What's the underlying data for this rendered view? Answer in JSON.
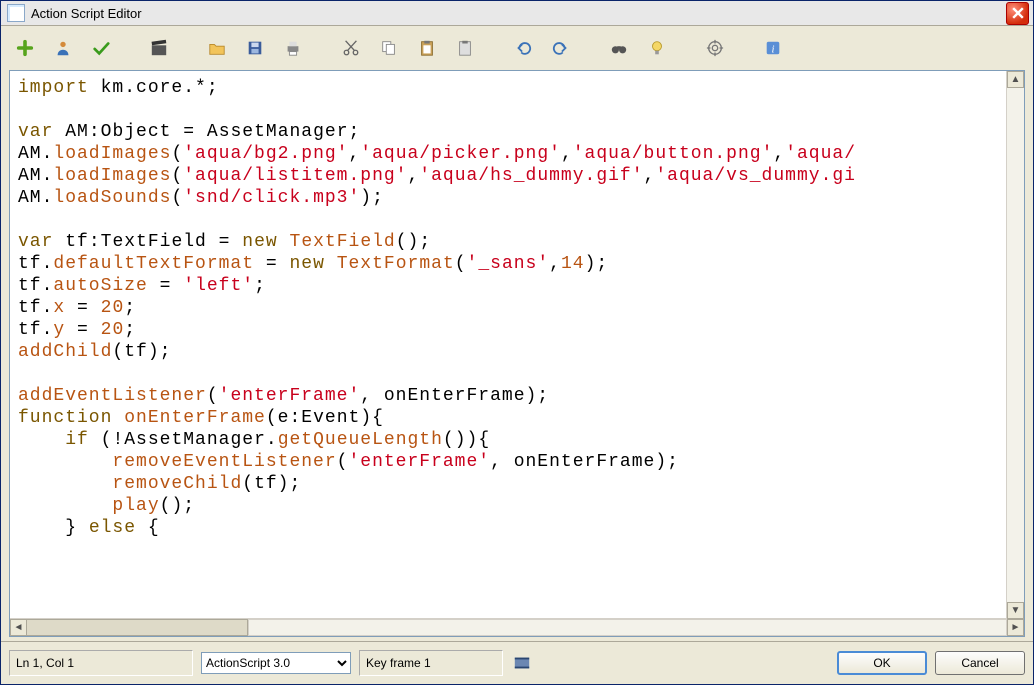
{
  "window": {
    "title": "Action Script Editor"
  },
  "toolbar": {
    "buttons": [
      "new-script",
      "user-assist",
      "syntax-check",
      "clapboard",
      "open",
      "save",
      "print",
      "cut",
      "copy",
      "paste",
      "copy-to-clipboard",
      "undo",
      "redo",
      "find",
      "help-hint",
      "target",
      "info"
    ]
  },
  "code": {
    "tokens": [
      [
        {
          "t": "kw",
          "v": "import"
        },
        {
          "t": "sp",
          "v": " "
        },
        {
          "t": "ident",
          "v": "km.core."
        },
        {
          "t": "punc",
          "v": "*;"
        }
      ],
      [],
      [
        {
          "t": "kw",
          "v": "var"
        },
        {
          "t": "sp",
          "v": " "
        },
        {
          "t": "ident",
          "v": "AM"
        },
        {
          "t": "punc",
          "v": ":"
        },
        {
          "t": "type",
          "v": "Object"
        },
        {
          "t": "sp",
          "v": " "
        },
        {
          "t": "punc",
          "v": "="
        },
        {
          "t": "sp",
          "v": " "
        },
        {
          "t": "ident",
          "v": "AssetManager"
        },
        {
          "t": "punc",
          "v": ";"
        }
      ],
      [
        {
          "t": "ident",
          "v": "AM."
        },
        {
          "t": "func",
          "v": "loadImages"
        },
        {
          "t": "punc",
          "v": "("
        },
        {
          "t": "str",
          "v": "'aqua/bg2.png'"
        },
        {
          "t": "punc",
          "v": ","
        },
        {
          "t": "str",
          "v": "'aqua/picker.png'"
        },
        {
          "t": "punc",
          "v": ","
        },
        {
          "t": "str",
          "v": "'aqua/button.png'"
        },
        {
          "t": "punc",
          "v": ","
        },
        {
          "t": "str",
          "v": "'aqua/"
        }
      ],
      [
        {
          "t": "ident",
          "v": "AM."
        },
        {
          "t": "func",
          "v": "loadImages"
        },
        {
          "t": "punc",
          "v": "("
        },
        {
          "t": "str",
          "v": "'aqua/listitem.png'"
        },
        {
          "t": "punc",
          "v": ","
        },
        {
          "t": "str",
          "v": "'aqua/hs_dummy.gif'"
        },
        {
          "t": "punc",
          "v": ","
        },
        {
          "t": "str",
          "v": "'aqua/vs_dummy.gi"
        }
      ],
      [
        {
          "t": "ident",
          "v": "AM."
        },
        {
          "t": "func",
          "v": "loadSounds"
        },
        {
          "t": "punc",
          "v": "("
        },
        {
          "t": "str",
          "v": "'snd/click.mp3'"
        },
        {
          "t": "punc",
          "v": ");"
        }
      ],
      [],
      [
        {
          "t": "kw",
          "v": "var"
        },
        {
          "t": "sp",
          "v": " "
        },
        {
          "t": "ident",
          "v": "tf"
        },
        {
          "t": "punc",
          "v": ":"
        },
        {
          "t": "type",
          "v": "TextField"
        },
        {
          "t": "sp",
          "v": " "
        },
        {
          "t": "punc",
          "v": "="
        },
        {
          "t": "sp",
          "v": " "
        },
        {
          "t": "kw",
          "v": "new"
        },
        {
          "t": "sp",
          "v": " "
        },
        {
          "t": "func",
          "v": "TextField"
        },
        {
          "t": "punc",
          "v": "();"
        }
      ],
      [
        {
          "t": "ident",
          "v": "tf."
        },
        {
          "t": "func",
          "v": "defaultTextFormat"
        },
        {
          "t": "sp",
          "v": " "
        },
        {
          "t": "punc",
          "v": "="
        },
        {
          "t": "sp",
          "v": " "
        },
        {
          "t": "kw",
          "v": "new"
        },
        {
          "t": "sp",
          "v": " "
        },
        {
          "t": "func",
          "v": "TextFormat"
        },
        {
          "t": "punc",
          "v": "("
        },
        {
          "t": "str",
          "v": "'_sans'"
        },
        {
          "t": "punc",
          "v": ","
        },
        {
          "t": "num",
          "v": "14"
        },
        {
          "t": "punc",
          "v": ");"
        }
      ],
      [
        {
          "t": "ident",
          "v": "tf."
        },
        {
          "t": "func",
          "v": "autoSize"
        },
        {
          "t": "sp",
          "v": " "
        },
        {
          "t": "punc",
          "v": "="
        },
        {
          "t": "sp",
          "v": " "
        },
        {
          "t": "str",
          "v": "'left'"
        },
        {
          "t": "punc",
          "v": ";"
        }
      ],
      [
        {
          "t": "ident",
          "v": "tf."
        },
        {
          "t": "func",
          "v": "x"
        },
        {
          "t": "sp",
          "v": " "
        },
        {
          "t": "punc",
          "v": "="
        },
        {
          "t": "sp",
          "v": " "
        },
        {
          "t": "num",
          "v": "20"
        },
        {
          "t": "punc",
          "v": ";"
        }
      ],
      [
        {
          "t": "ident",
          "v": "tf."
        },
        {
          "t": "func",
          "v": "y"
        },
        {
          "t": "sp",
          "v": " "
        },
        {
          "t": "punc",
          "v": "="
        },
        {
          "t": "sp",
          "v": " "
        },
        {
          "t": "num",
          "v": "20"
        },
        {
          "t": "punc",
          "v": ";"
        }
      ],
      [
        {
          "t": "func",
          "v": "addChild"
        },
        {
          "t": "punc",
          "v": "("
        },
        {
          "t": "ident",
          "v": "tf"
        },
        {
          "t": "punc",
          "v": ");"
        }
      ],
      [],
      [
        {
          "t": "func",
          "v": "addEventListener"
        },
        {
          "t": "punc",
          "v": "("
        },
        {
          "t": "str",
          "v": "'enterFrame'"
        },
        {
          "t": "punc",
          "v": ", "
        },
        {
          "t": "ident",
          "v": "onEnterFrame"
        },
        {
          "t": "punc",
          "v": ");"
        }
      ],
      [
        {
          "t": "kw",
          "v": "function"
        },
        {
          "t": "sp",
          "v": " "
        },
        {
          "t": "func",
          "v": "onEnterFrame"
        },
        {
          "t": "punc",
          "v": "("
        },
        {
          "t": "ident",
          "v": "e"
        },
        {
          "t": "punc",
          "v": ":"
        },
        {
          "t": "type",
          "v": "Event"
        },
        {
          "t": "punc",
          "v": "){"
        }
      ],
      [
        {
          "t": "sp",
          "v": "    "
        },
        {
          "t": "kw",
          "v": "if"
        },
        {
          "t": "sp",
          "v": " "
        },
        {
          "t": "punc",
          "v": "(!"
        },
        {
          "t": "ident",
          "v": "AssetManager."
        },
        {
          "t": "func",
          "v": "getQueueLength"
        },
        {
          "t": "punc",
          "v": "()){"
        }
      ],
      [
        {
          "t": "sp",
          "v": "        "
        },
        {
          "t": "func",
          "v": "removeEventListener"
        },
        {
          "t": "punc",
          "v": "("
        },
        {
          "t": "str",
          "v": "'enterFrame'"
        },
        {
          "t": "punc",
          "v": ", "
        },
        {
          "t": "ident",
          "v": "onEnterFrame"
        },
        {
          "t": "punc",
          "v": ");"
        }
      ],
      [
        {
          "t": "sp",
          "v": "        "
        },
        {
          "t": "func",
          "v": "removeChild"
        },
        {
          "t": "punc",
          "v": "("
        },
        {
          "t": "ident",
          "v": "tf"
        },
        {
          "t": "punc",
          "v": ");"
        }
      ],
      [
        {
          "t": "sp",
          "v": "        "
        },
        {
          "t": "func",
          "v": "play"
        },
        {
          "t": "punc",
          "v": "();"
        }
      ],
      [
        {
          "t": "sp",
          "v": "    "
        },
        {
          "t": "punc",
          "v": "} "
        },
        {
          "t": "kw",
          "v": "else"
        },
        {
          "t": "punc",
          "v": " {"
        }
      ]
    ]
  },
  "status": {
    "position": "Ln 1, Col 1",
    "language_options": [
      "ActionScript 3.0"
    ],
    "language_selected": "ActionScript 3.0",
    "keyframe": "Key frame 1"
  },
  "buttons": {
    "ok": "OK",
    "cancel": "Cancel"
  }
}
